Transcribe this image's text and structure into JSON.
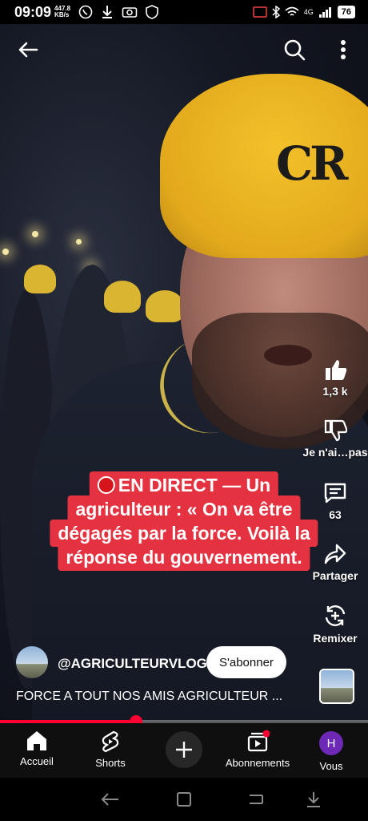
{
  "status_bar": {
    "time": "09:09",
    "net_speed_value": "447.8",
    "net_speed_unit": "KB/s",
    "signal_label": "4G",
    "battery": "76"
  },
  "video": {
    "caption_lines": [
      "EN DIRECT — Un",
      "agriculteur : « On va être",
      "dégagés par la force. Voilà la",
      "réponse du gouvernement."
    ],
    "hat_logo": "CR"
  },
  "actions": {
    "like_count": "1,3 k",
    "dislike_label": "Je n'ai…pas",
    "comments_count": "63",
    "share_label": "Partager",
    "remix_label": "Remixer"
  },
  "channel": {
    "handle": "@AGRICULTEURVLOG",
    "subscribe_label": "S'abonner",
    "description": "FORCE A TOUT NOS AMIS AGRICULTEUR ..."
  },
  "progress": {
    "fraction": 0.37
  },
  "bottom_nav": {
    "items": [
      {
        "label": "Accueil",
        "icon": "home-icon"
      },
      {
        "label": "Shorts",
        "icon": "shorts-icon"
      },
      {
        "label": "",
        "icon": "create-icon"
      },
      {
        "label": "Abonnements",
        "icon": "subscriptions-icon"
      },
      {
        "label": "Vous",
        "icon": "avatar"
      }
    ],
    "you_initial": "H"
  },
  "colors": {
    "accent": "#ff0033",
    "caption_bg": "#e53240",
    "live_dot": "#d5151b",
    "avatar_bg": "#6d28b5"
  }
}
